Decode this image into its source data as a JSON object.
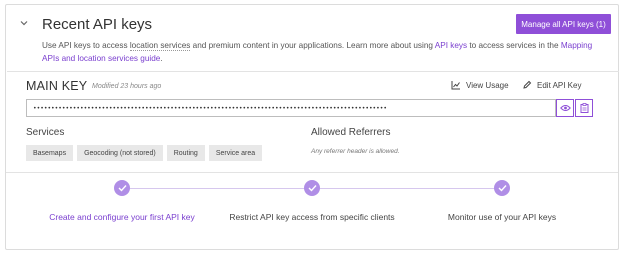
{
  "header": {
    "title": "Recent API keys",
    "manage_button": "Manage all API keys (1)"
  },
  "description": {
    "text1": "Use API keys to access ",
    "link_location": "location services",
    "text2": " and premium content in your applications. Learn more about using ",
    "link_api_keys": "API keys",
    "text3": " to access services in the ",
    "link_guide": "Mapping APIs and location services guide",
    "text4": "."
  },
  "key": {
    "name": "MAIN KEY",
    "modified": "Modified 23 hours ago",
    "masked_value": "••••••••••••••••••••••••••••••••••••••••••••••••••••••••••••••••••••••••••••••••••••••••••••••••••",
    "view_usage": "View Usage",
    "edit": "Edit API Key"
  },
  "services": {
    "label": "Services",
    "items": [
      "Basemaps",
      "Geocoding (not stored)",
      "Routing",
      "Service area"
    ]
  },
  "referrers": {
    "label": "Allowed Referrers",
    "empty": "Any referrer header is allowed."
  },
  "steps": [
    {
      "label": "Create and configure your first API key"
    },
    {
      "label": "Restrict API key access from specific clients"
    },
    {
      "label": "Monitor use of your API keys"
    }
  ],
  "colors": {
    "accent": "#8f4fd8",
    "step_dot": "#b08ee6"
  }
}
